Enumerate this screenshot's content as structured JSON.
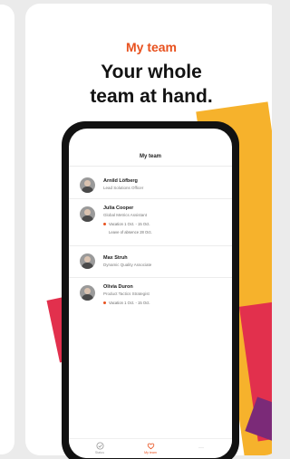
{
  "headline": {
    "eyebrow": "My team",
    "line1": "Your whole",
    "line2": "team at hand."
  },
  "phone": {
    "screen_title": "My team",
    "members": [
      {
        "name": "Arnild Löfberg",
        "role": "Lead Solutions Officer"
      },
      {
        "name": "Julia Cooper",
        "role": "Global Metrics Assistant",
        "statuses": [
          "Vacation 1 Oct. - 15 Oct.",
          "Leave of absence 28 Oct."
        ]
      },
      {
        "name": "Max Struh",
        "role": "Dynamic Quality Associate"
      },
      {
        "name": "Olivia Duron",
        "role": "Product Tactics Strategist",
        "statuses": [
          "Vacation 1 Oct. - 15 Oct."
        ]
      }
    ],
    "tabs": [
      {
        "label": "Status",
        "icon": "check-circle-icon",
        "active": false
      },
      {
        "label": "My team",
        "icon": "heart-icon",
        "active": true
      },
      {
        "label": "···",
        "icon": "more-icon",
        "active": false
      }
    ]
  },
  "colors": {
    "accent": "#e8511e",
    "orange": "#f6b22c",
    "red": "#e2304d",
    "purple": "#7b2a78",
    "phone_frame": "#121212"
  }
}
